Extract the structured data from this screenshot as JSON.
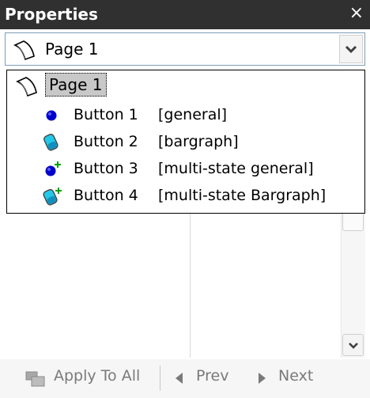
{
  "panel": {
    "title": "Properties",
    "close_glyph": "×"
  },
  "selector": {
    "value": "Page 1",
    "icon": "page-icon"
  },
  "tree": {
    "root": {
      "label": "Page 1",
      "icon": "page-icon"
    },
    "items": [
      {
        "name": "Button 1",
        "type": "[general]",
        "icon": "blue-dot-icon"
      },
      {
        "name": "Button 2",
        "type": "[bargraph]",
        "icon": "bargraph-icon"
      },
      {
        "name": "Button 3",
        "type": "[multi-state general]",
        "icon": "multi-state-dot-icon"
      },
      {
        "name": "Button 4",
        "type": "[multi-state Bargraph]",
        "icon": "multi-state-bargraph-icon"
      }
    ]
  },
  "toolbar": {
    "apply_label": "Apply To All",
    "prev_label": "Prev",
    "next_label": "Next"
  },
  "colors": {
    "title_bar": "#303030",
    "selection": "#c8c8c8",
    "disabled_text": "#7a7a7a",
    "dot_blue": "#0000cc",
    "bargraph_cyan": "#22c8e8",
    "plus_green": "#00a000"
  }
}
